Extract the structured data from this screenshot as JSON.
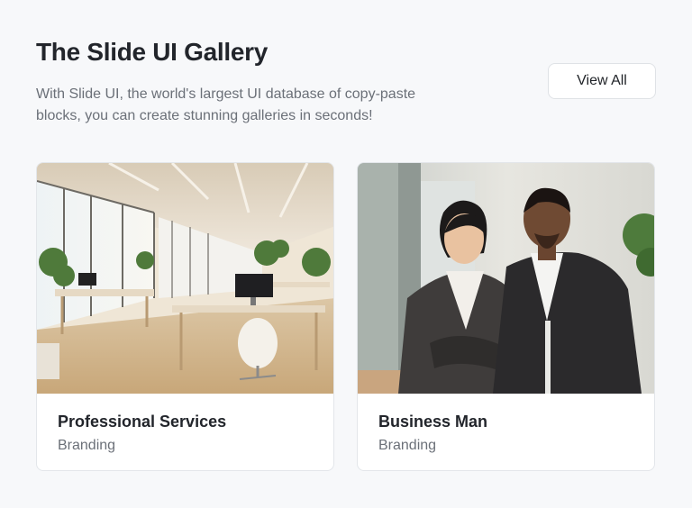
{
  "header": {
    "title": "The Slide UI Gallery",
    "description": "With Slide UI, the world's largest UI database of copy-paste blocks, you can create stunning galleries in seconds!",
    "view_all_label": "View All"
  },
  "cards": [
    {
      "title": "Professional Services",
      "category": "Branding",
      "image": "office-interior-photo"
    },
    {
      "title": "Business Man",
      "category": "Branding",
      "image": "business-people-photo"
    }
  ],
  "colors": {
    "background": "#f7f8fa",
    "title": "#22252b",
    "muted_text": "#6b7078",
    "border": "#e3e6ea"
  }
}
